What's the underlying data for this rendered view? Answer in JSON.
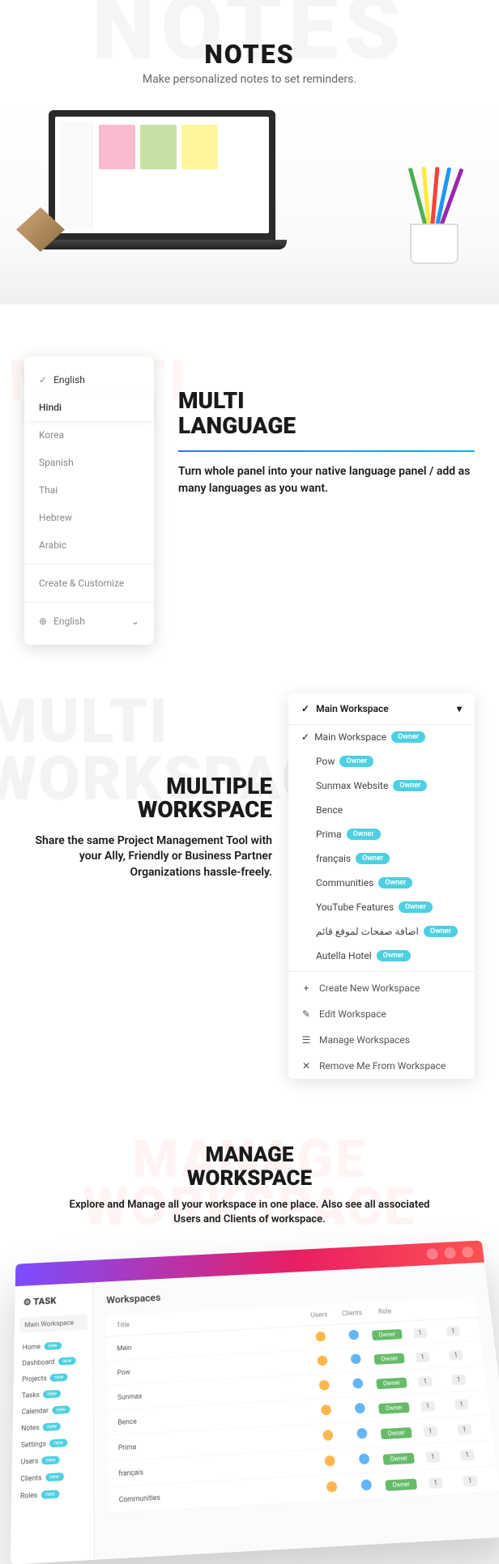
{
  "notes": {
    "bg": "NOTES",
    "title": "NOTES",
    "subtitle": "Make personalized notes to set reminders."
  },
  "multiLang": {
    "bg": "MULTI",
    "title1": "MULTI",
    "title2": "LANGUAGE",
    "desc": "Turn whole panel into your native language panel / add as many languages as you want.",
    "selected": "English",
    "items": [
      "English",
      "Hindi",
      "Korea",
      "Spanish",
      "Thai",
      "Hebrew",
      "Arabic"
    ],
    "customize": "Create & Customize",
    "footer": "English"
  },
  "multiWs": {
    "bg1": "MULTI",
    "bg2": "WORKSPACE",
    "title1": "MULTIPLE",
    "title2": "WORKSPACE",
    "desc": "Share the same Project Management Tool with your Ally, Friendly or Business Partner Organizations hassle-freely.",
    "header": "Main Workspace",
    "badge": "Owner",
    "items": [
      {
        "name": "Main Workspace",
        "owner": true,
        "checked": true
      },
      {
        "name": "Pow",
        "owner": true
      },
      {
        "name": "Sunmax Website",
        "owner": true
      },
      {
        "name": "Bence",
        "owner": false
      },
      {
        "name": "Prima",
        "owner": true
      },
      {
        "name": "français",
        "owner": true
      },
      {
        "name": "Communities",
        "owner": true
      },
      {
        "name": "YouTube Features",
        "owner": true
      },
      {
        "name": "اضافة صفحات لموقع قائم",
        "owner": true
      },
      {
        "name": "Autella Hotel",
        "owner": true
      }
    ],
    "actions": [
      {
        "icon": "+",
        "label": "Create New Workspace"
      },
      {
        "icon": "✎",
        "label": "Edit Workspace"
      },
      {
        "icon": "☰",
        "label": "Manage Workspaces"
      },
      {
        "icon": "✕",
        "label": "Remove Me From Workspace"
      }
    ]
  },
  "manageWs": {
    "bg1": "MANAGE",
    "bg2": "WORKSPACE",
    "title1": "MANAGE",
    "title2": "WORKSPACE",
    "desc": "Explore and Manage all your workspace in one place. Also see all associated Users and Clients of workspace.",
    "logo": "TASK",
    "pageTitle": "Workspaces",
    "sideSelect": "Main Workspace",
    "sideLinks": [
      "Home",
      "Dashboard",
      "Projects",
      "Tasks",
      "Calendar",
      "Notes",
      "Settings",
      "Users",
      "Clients",
      "Roles"
    ],
    "tableCols": {
      "title": "Title",
      "users": "Users",
      "clients": "Clients",
      "role": "Role",
      "c1": "",
      "c2": ""
    },
    "roleLabel": "Owner",
    "rows": [
      {
        "title": "Main"
      },
      {
        "title": "Pow"
      },
      {
        "title": "Sunmax"
      },
      {
        "title": "Bence"
      },
      {
        "title": "Prima"
      },
      {
        "title": "français"
      },
      {
        "title": "Communities"
      }
    ]
  }
}
